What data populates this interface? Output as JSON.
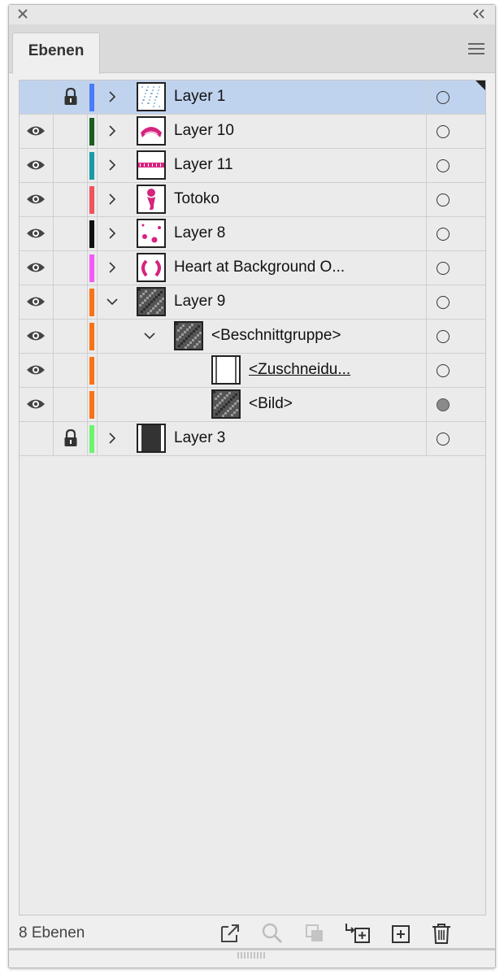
{
  "panel": {
    "tab_label": "Ebenen",
    "status_text": "8 Ebenen"
  },
  "colors": {
    "selection": "#c0d3ee",
    "panel_bg": "#efefef",
    "magenta_art": "#d6247f"
  },
  "icons": {
    "close": "close-icon",
    "collapse": "double-chevron-left-icon",
    "menu": "hamburger-menu-icon",
    "visibility": "eye-icon",
    "lock": "lock-icon",
    "expand": "chevron-right-icon",
    "collapse_row": "chevron-down-icon",
    "target": "target-circle-icon"
  },
  "layers": [
    {
      "label": "Layer 1",
      "visible": false,
      "locked": true,
      "color": "#4a7cf7",
      "depth": 0,
      "expander": "right",
      "selected": true,
      "target_filled": false,
      "thumb": "dots"
    },
    {
      "label": "Layer 10",
      "visible": true,
      "locked": false,
      "color": "#1b5e20",
      "depth": 0,
      "expander": "right",
      "selected": false,
      "target_filled": false,
      "thumb": "arc-text"
    },
    {
      "label": "Layer 11",
      "visible": true,
      "locked": false,
      "color": "#1a9aa6",
      "depth": 0,
      "expander": "right",
      "selected": false,
      "target_filled": false,
      "thumb": "totoko-text"
    },
    {
      "label": "Totoko",
      "visible": true,
      "locked": false,
      "color": "#f0545c",
      "depth": 0,
      "expander": "right",
      "selected": false,
      "target_filled": false,
      "thumb": "figure"
    },
    {
      "label": "Layer 8",
      "visible": true,
      "locked": false,
      "color": "#111111",
      "depth": 0,
      "expander": "right",
      "selected": false,
      "target_filled": false,
      "thumb": "hearts"
    },
    {
      "label": "Heart at Background O...",
      "visible": true,
      "locked": false,
      "color": "#f25cf5",
      "depth": 0,
      "expander": "right",
      "selected": false,
      "target_filled": false,
      "thumb": "heart-outline"
    },
    {
      "label": "Layer 9",
      "visible": true,
      "locked": false,
      "color": "#f97316",
      "depth": 0,
      "expander": "down",
      "selected": false,
      "target_filled": false,
      "thumb": "photo"
    },
    {
      "label": "<Beschnittgruppe>",
      "visible": true,
      "locked": false,
      "color": "#f97316",
      "depth": 1,
      "expander": "down",
      "selected": false,
      "target_filled": false,
      "thumb": "photo"
    },
    {
      "label": "<Zuschneidu...",
      "visible": true,
      "locked": false,
      "color": "#f97316",
      "depth": 2,
      "expander": "none",
      "selected": false,
      "target_filled": false,
      "thumb": "clip-rect",
      "underline": true
    },
    {
      "label": "<Bild>",
      "visible": true,
      "locked": false,
      "color": "#f97316",
      "depth": 2,
      "expander": "none",
      "selected": false,
      "target_filled": true,
      "thumb": "photo"
    },
    {
      "label": "Layer 3",
      "visible": false,
      "locked": true,
      "color": "#6cf56c",
      "depth": 0,
      "expander": "right",
      "selected": false,
      "target_filled": false,
      "thumb": "dark-rect"
    }
  ],
  "footer_icons": [
    {
      "name": "export-icon",
      "enabled": true
    },
    {
      "name": "search-icon",
      "enabled": false
    },
    {
      "name": "clip-mask-icon",
      "enabled": false
    },
    {
      "name": "new-sublayer-icon",
      "enabled": true
    },
    {
      "name": "new-layer-icon",
      "enabled": true
    },
    {
      "name": "trash-icon",
      "enabled": true
    }
  ]
}
